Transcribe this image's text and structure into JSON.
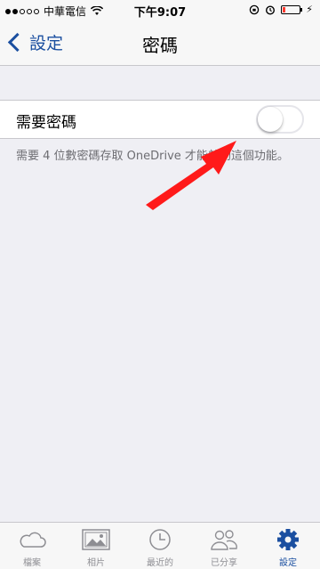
{
  "status_bar": {
    "carrier": "中華電信",
    "time": "下午9:07",
    "battery_level": 0.15,
    "battery_color": "#ff3b30"
  },
  "nav": {
    "back_label": "設定",
    "title": "密碼",
    "accent_color": "#1b4fa0"
  },
  "setting": {
    "label": "需要密碼",
    "toggle_on": false
  },
  "footnote": "需要 4 位數密碼存取 OneDrive 才能啟動這個功能。",
  "tabs": [
    {
      "label": "檔案",
      "icon": "cloud-icon",
      "active": false
    },
    {
      "label": "相片",
      "icon": "photos-icon",
      "active": false
    },
    {
      "label": "最近的",
      "icon": "clock-icon",
      "active": false
    },
    {
      "label": "已分享",
      "icon": "people-icon",
      "active": false
    },
    {
      "label": "設定",
      "icon": "gear-icon",
      "active": true
    }
  ]
}
